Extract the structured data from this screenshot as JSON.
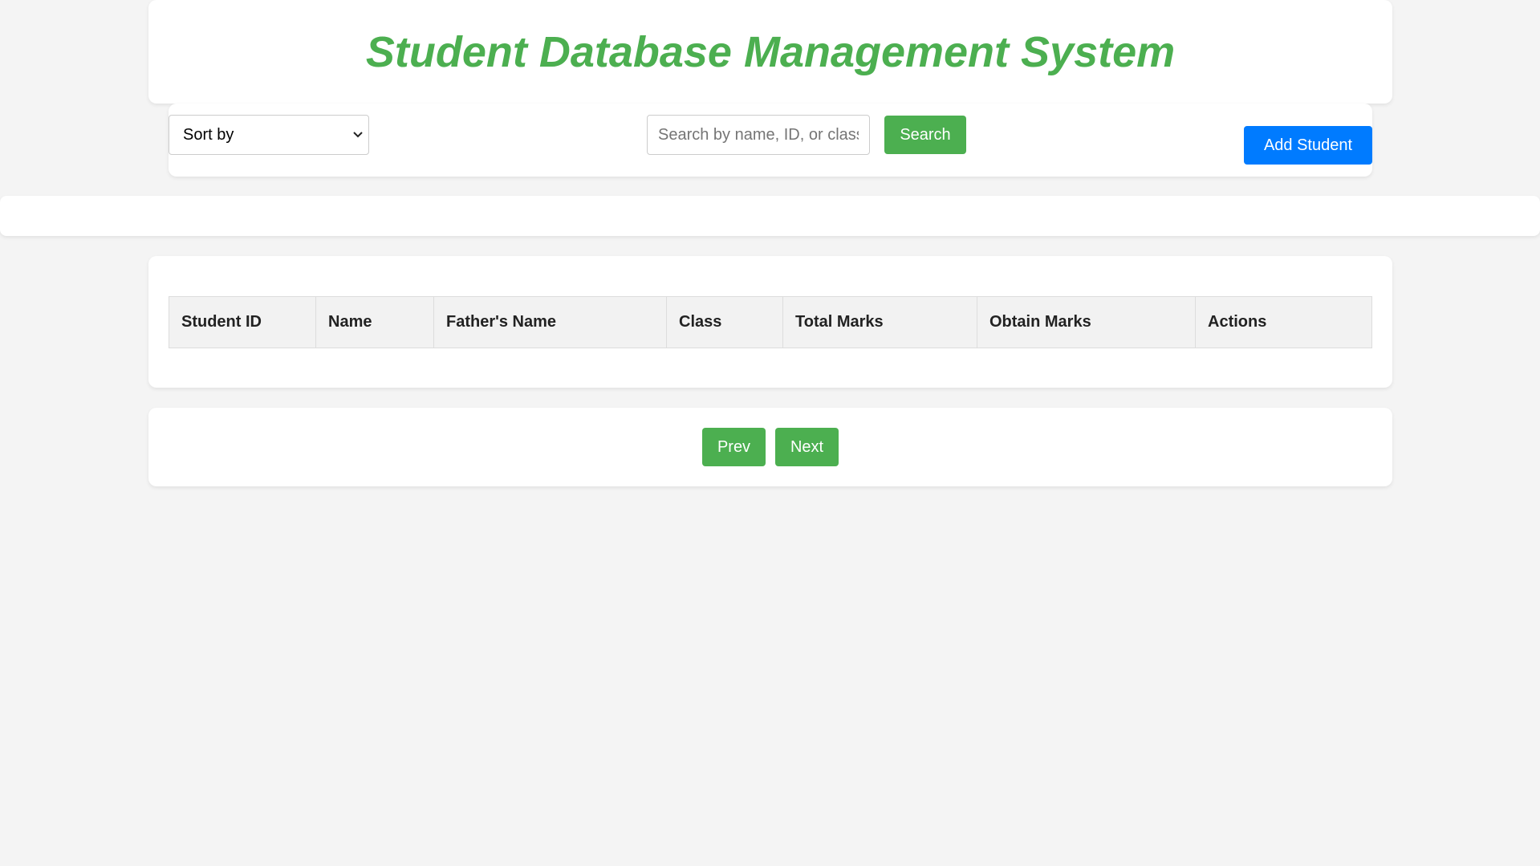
{
  "header": {
    "title": "Student Database Management System"
  },
  "toolbar": {
    "sort": {
      "selected": "Sort by"
    },
    "search": {
      "placeholder": "Search by name, ID, or class",
      "value": "",
      "button_label": "Search"
    },
    "add_button_label": "Add Student"
  },
  "message": "",
  "table": {
    "columns": [
      "Student ID",
      "Name",
      "Father's Name",
      "Class",
      "Total Marks",
      "Obtain Marks",
      "Actions"
    ],
    "rows": []
  },
  "pagination": {
    "prev_label": "Prev",
    "next_label": "Next"
  },
  "colors": {
    "accent_green": "#4caf50",
    "primary_blue": "#007bff",
    "background": "#f4f4f4",
    "header_cell": "#f2f2f2"
  },
  "icons": {
    "sort_dropdown": "chevron-down-icon"
  }
}
